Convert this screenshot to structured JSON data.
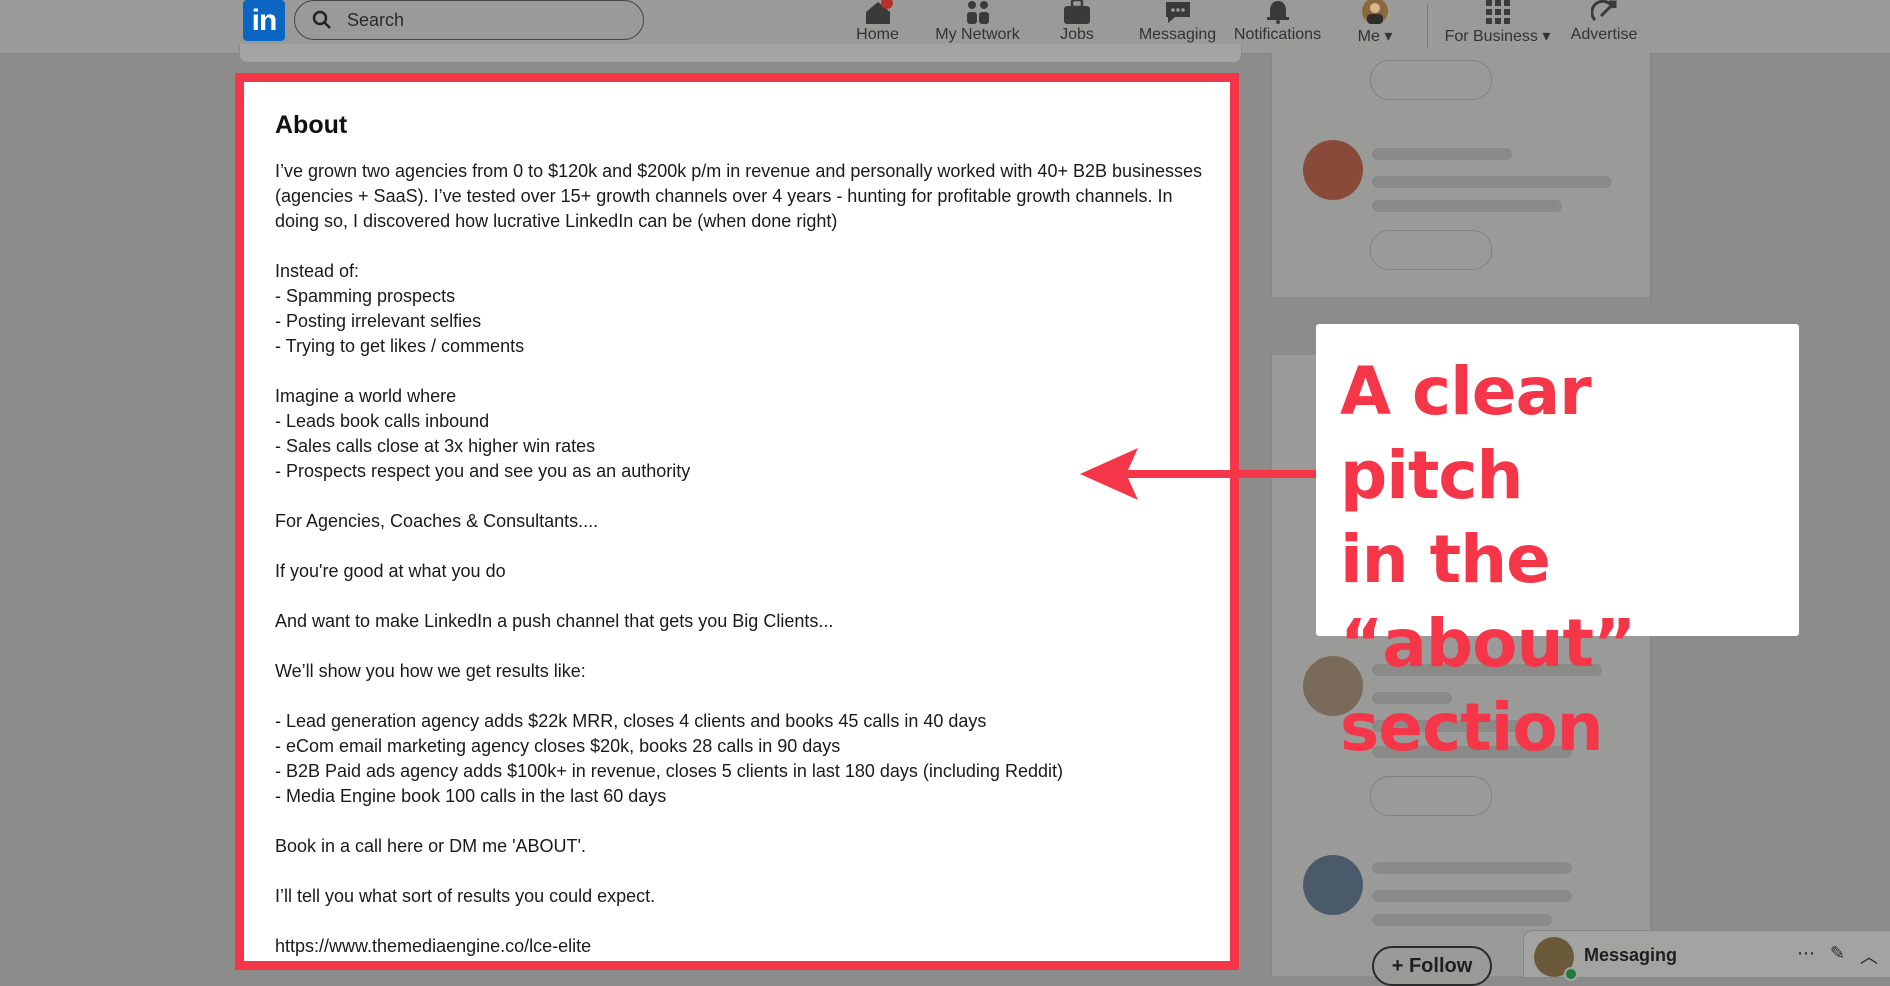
{
  "nav": {
    "logo": "in",
    "search_placeholder": "Search",
    "items": [
      {
        "label": "Home",
        "icon": "home-icon"
      },
      {
        "label": "My Network",
        "icon": "network-icon"
      },
      {
        "label": "Jobs",
        "icon": "briefcase-icon"
      },
      {
        "label": "Messaging",
        "icon": "chat-icon"
      },
      {
        "label": "Notifications",
        "icon": "bell-icon"
      },
      {
        "label": "Me",
        "icon": "avatar"
      },
      {
        "label": "For Business",
        "icon": "grid-icon"
      },
      {
        "label": "Advertise",
        "icon": "advertise-icon"
      }
    ]
  },
  "about": {
    "title": "About",
    "body": "I’ve grown two agencies from 0 to $120k and $200k p/m in revenue and personally worked with 40+ B2B businesses\n(agencies + SaaS). I’ve tested over 15+ growth channels over 4 years - hunting for profitable growth channels. In\ndoing so, I discovered how lucrative LinkedIn can be (when done right)\n\nInstead of:\n- Spamming prospects\n- Posting irrelevant selfies\n- Trying to get likes / comments\n\nImagine a world where\n- Leads book calls inbound\n- Sales calls close at 3x higher win rates\n- Prospects respect you and see you as an authority\n\nFor Agencies, Coaches & Consultants....\n\nIf you're good at what you do\n\nAnd want to make LinkedIn a push channel that gets you Big Clients...\n\nWe’ll show you how we get results like:\n\n- Lead generation agency adds $22k MRR, closes 4 clients and books 45 calls in 40 days\n- eCom email marketing agency closes $20k, books 28 calls in 90 days\n- B2B Paid ads agency adds $100k+ in revenue, closes 5 clients in last 180 days (including Reddit)\n- Media Engine book 100 calls in the last 60 days\n\nBook in a call here or DM me 'ABOUT'.\n\nI’ll tell you what sort of results you could expect.\n\nhttps://www.themediaengine.co/lce-elite"
  },
  "annotation": {
    "text": "A clear pitch\nin the “about”\nsection",
    "color": "#f53649"
  },
  "sidebar": {
    "follow_label": "+ Follow"
  },
  "messaging": {
    "label": "Messaging"
  },
  "colors": {
    "brand": "#0a66c2",
    "highlight": "#f53649"
  }
}
